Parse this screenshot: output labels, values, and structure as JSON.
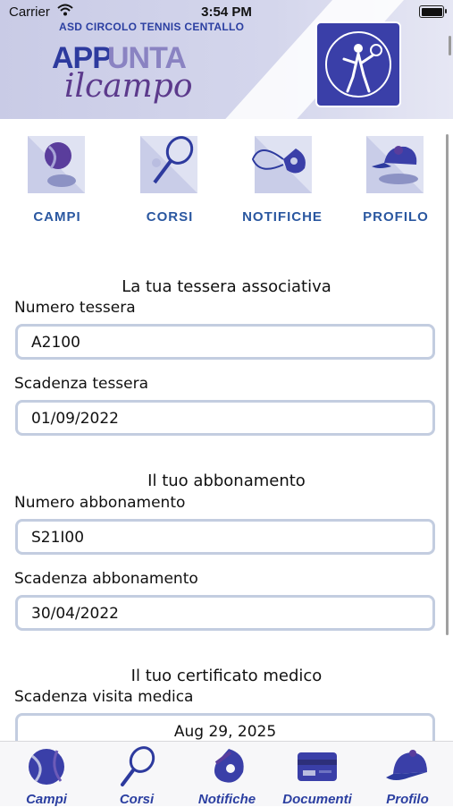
{
  "status_bar": {
    "carrier": "Carrier",
    "time": "3:54 PM"
  },
  "header": {
    "club_name": "ASD CIRCOLO TENNIS CENTALLO",
    "logo_app": "APP",
    "logo_punta": "UNTA",
    "logo_sub": "ilcampo"
  },
  "top_nav": [
    {
      "label": "CAMPI",
      "icon": "tennis-ball-icon"
    },
    {
      "label": "CORSI",
      "icon": "racket-icon"
    },
    {
      "label": "NOTIFICHE",
      "icon": "whistle-icon"
    },
    {
      "label": "PROFILO",
      "icon": "cap-icon"
    }
  ],
  "tessera": {
    "title": "La tua tessera associativa",
    "numero_label": "Numero tessera",
    "numero_value": "A2100",
    "scadenza_label": "Scadenza tessera",
    "scadenza_value": "01/09/2022"
  },
  "abbonamento": {
    "title": "Il tuo abbonamento",
    "numero_label": "Numero abbonamento",
    "numero_value": "S21I00",
    "scadenza_label": "Scadenza abbonamento",
    "scadenza_value": "30/04/2022"
  },
  "certificato": {
    "title": "Il tuo certificato medico",
    "scadenza_label": "Scadenza visita medica",
    "scadenza_value": "Aug 29, 2025"
  },
  "tab_bar": [
    {
      "label": "Campi",
      "icon": "tennis-ball-icon"
    },
    {
      "label": "Corsi",
      "icon": "racket-icon"
    },
    {
      "label": "Notifiche",
      "icon": "whistle-icon"
    },
    {
      "label": "Documenti",
      "icon": "card-icon"
    },
    {
      "label": "Profilo",
      "icon": "cap-icon"
    }
  ],
  "colors": {
    "brand_blue": "#2b3fa1",
    "nav_label_blue": "#2a57a0",
    "header_lavender": "#c9cbe6",
    "field_border": "#c3cde0"
  }
}
